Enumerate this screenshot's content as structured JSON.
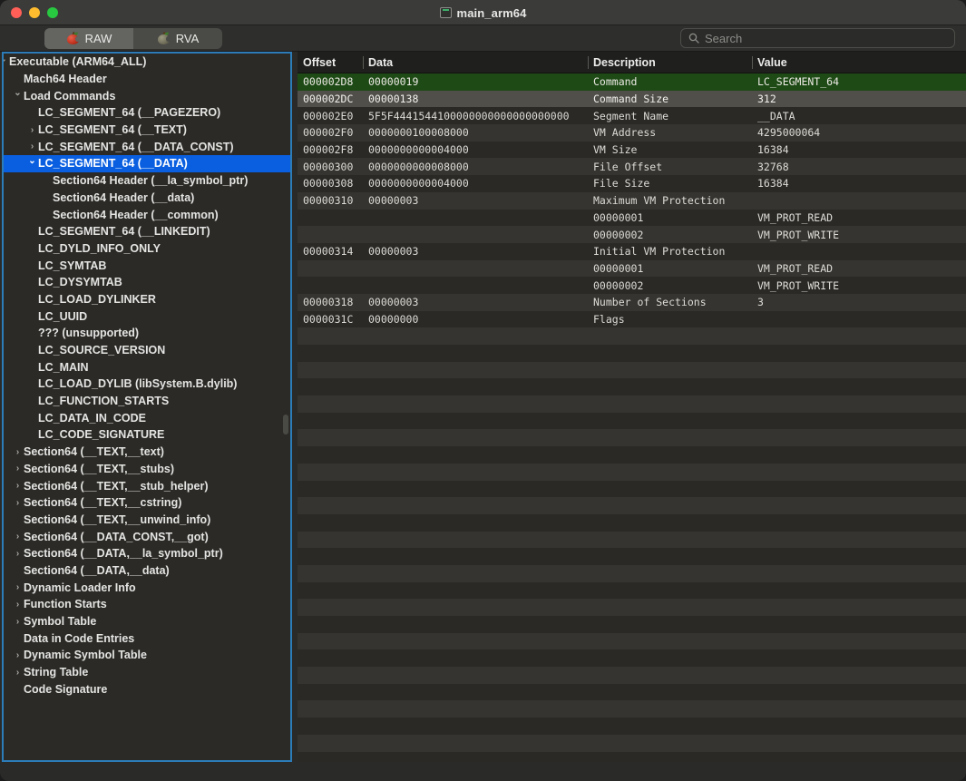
{
  "window": {
    "title": "main_arm64",
    "traffic_lights": [
      "close",
      "minimize",
      "maximize"
    ],
    "colors": {
      "close": "#ff5f57",
      "minimize": "#febc2e",
      "maximize": "#28c840",
      "selection_blue": "#0a5fe0",
      "focus_ring": "#2b7cb8",
      "row_selected_green": "#1e4a16"
    }
  },
  "toolbar": {
    "tabs": [
      {
        "label": "RAW",
        "icon": "apple-red-icon",
        "active": true
      },
      {
        "label": "RVA",
        "icon": "apple-grey-icon",
        "active": false
      }
    ],
    "search": {
      "placeholder": "Search",
      "value": "",
      "icon": "search-icon"
    }
  },
  "sidebar": {
    "items": [
      {
        "label": "Executable  (ARM64_ALL)",
        "depth": 0,
        "twisty": "down",
        "selected": false
      },
      {
        "label": "Mach64 Header",
        "depth": 1,
        "twisty": "none",
        "selected": false
      },
      {
        "label": "Load Commands",
        "depth": 1,
        "twisty": "down",
        "selected": false
      },
      {
        "label": "LC_SEGMENT_64 (__PAGEZERO)",
        "depth": 2,
        "twisty": "none",
        "selected": false
      },
      {
        "label": "LC_SEGMENT_64 (__TEXT)",
        "depth": 2,
        "twisty": "right",
        "selected": false
      },
      {
        "label": "LC_SEGMENT_64 (__DATA_CONST)",
        "depth": 2,
        "twisty": "right",
        "selected": false
      },
      {
        "label": "LC_SEGMENT_64 (__DATA)",
        "depth": 2,
        "twisty": "down",
        "selected": true
      },
      {
        "label": "Section64 Header (__la_symbol_ptr)",
        "depth": 3,
        "twisty": "none",
        "selected": false
      },
      {
        "label": "Section64 Header (__data)",
        "depth": 3,
        "twisty": "none",
        "selected": false
      },
      {
        "label": "Section64 Header (__common)",
        "depth": 3,
        "twisty": "none",
        "selected": false
      },
      {
        "label": "LC_SEGMENT_64 (__LINKEDIT)",
        "depth": 2,
        "twisty": "none",
        "selected": false
      },
      {
        "label": "LC_DYLD_INFO_ONLY",
        "depth": 2,
        "twisty": "none",
        "selected": false
      },
      {
        "label": "LC_SYMTAB",
        "depth": 2,
        "twisty": "none",
        "selected": false
      },
      {
        "label": "LC_DYSYMTAB",
        "depth": 2,
        "twisty": "none",
        "selected": false
      },
      {
        "label": "LC_LOAD_DYLINKER",
        "depth": 2,
        "twisty": "none",
        "selected": false
      },
      {
        "label": "LC_UUID",
        "depth": 2,
        "twisty": "none",
        "selected": false
      },
      {
        "label": "??? (unsupported)",
        "depth": 2,
        "twisty": "none",
        "selected": false
      },
      {
        "label": "LC_SOURCE_VERSION",
        "depth": 2,
        "twisty": "none",
        "selected": false
      },
      {
        "label": "LC_MAIN",
        "depth": 2,
        "twisty": "none",
        "selected": false
      },
      {
        "label": "LC_LOAD_DYLIB (libSystem.B.dylib)",
        "depth": 2,
        "twisty": "none",
        "selected": false
      },
      {
        "label": "LC_FUNCTION_STARTS",
        "depth": 2,
        "twisty": "none",
        "selected": false
      },
      {
        "label": "LC_DATA_IN_CODE",
        "depth": 2,
        "twisty": "none",
        "selected": false
      },
      {
        "label": "LC_CODE_SIGNATURE",
        "depth": 2,
        "twisty": "none",
        "selected": false
      },
      {
        "label": "Section64 (__TEXT,__text)",
        "depth": 1,
        "twisty": "right",
        "selected": false
      },
      {
        "label": "Section64 (__TEXT,__stubs)",
        "depth": 1,
        "twisty": "right",
        "selected": false
      },
      {
        "label": "Section64 (__TEXT,__stub_helper)",
        "depth": 1,
        "twisty": "right",
        "selected": false
      },
      {
        "label": "Section64 (__TEXT,__cstring)",
        "depth": 1,
        "twisty": "right",
        "selected": false
      },
      {
        "label": "Section64 (__TEXT,__unwind_info)",
        "depth": 1,
        "twisty": "none",
        "selected": false
      },
      {
        "label": "Section64 (__DATA_CONST,__got)",
        "depth": 1,
        "twisty": "right",
        "selected": false
      },
      {
        "label": "Section64 (__DATA,__la_symbol_ptr)",
        "depth": 1,
        "twisty": "right",
        "selected": false
      },
      {
        "label": "Section64 (__DATA,__data)",
        "depth": 1,
        "twisty": "none",
        "selected": false
      },
      {
        "label": "Dynamic Loader Info",
        "depth": 1,
        "twisty": "right",
        "selected": false
      },
      {
        "label": "Function Starts",
        "depth": 1,
        "twisty": "right",
        "selected": false
      },
      {
        "label": "Symbol Table",
        "depth": 1,
        "twisty": "right",
        "selected": false
      },
      {
        "label": "Data in Code Entries",
        "depth": 1,
        "twisty": "none",
        "selected": false
      },
      {
        "label": "Dynamic Symbol Table",
        "depth": 1,
        "twisty": "right",
        "selected": false
      },
      {
        "label": "String Table",
        "depth": 1,
        "twisty": "right",
        "selected": false
      },
      {
        "label": "Code Signature",
        "depth": 1,
        "twisty": "none",
        "selected": false
      }
    ]
  },
  "table": {
    "columns": [
      "Offset",
      "Data",
      "Description",
      "Value"
    ],
    "rows": [
      {
        "offset": "000002D8",
        "data": "00000019",
        "description": "Command",
        "value": "LC_SEGMENT_64",
        "state": "selected"
      },
      {
        "offset": "000002DC",
        "data": "00000138",
        "description": "Command Size",
        "value": "312",
        "state": "selected2"
      },
      {
        "offset": "000002E0",
        "data": "5F5F4441544100000000000000000000",
        "description": "Segment Name",
        "value": "__DATA",
        "state": "odd"
      },
      {
        "offset": "000002F0",
        "data": "0000000100008000",
        "description": "VM Address",
        "value": "4295000064",
        "state": "even"
      },
      {
        "offset": "000002F8",
        "data": "0000000000004000",
        "description": "VM Size",
        "value": "16384",
        "state": "odd"
      },
      {
        "offset": "00000300",
        "data": "0000000000008000",
        "description": "File Offset",
        "value": "32768",
        "state": "even"
      },
      {
        "offset": "00000308",
        "data": "0000000000004000",
        "description": "File Size",
        "value": "16384",
        "state": "odd"
      },
      {
        "offset": "00000310",
        "data": "00000003",
        "description": "Maximum VM Protection",
        "value": "",
        "state": "even"
      },
      {
        "offset": "",
        "data": "",
        "description": "00000001",
        "value": "VM_PROT_READ",
        "state": "odd"
      },
      {
        "offset": "",
        "data": "",
        "description": "00000002",
        "value": "VM_PROT_WRITE",
        "state": "even"
      },
      {
        "offset": "00000314",
        "data": "00000003",
        "description": "Initial VM Protection",
        "value": "",
        "state": "odd"
      },
      {
        "offset": "",
        "data": "",
        "description": "00000001",
        "value": "VM_PROT_READ",
        "state": "even"
      },
      {
        "offset": "",
        "data": "",
        "description": "00000002",
        "value": "VM_PROT_WRITE",
        "state": "odd"
      },
      {
        "offset": "00000318",
        "data": "00000003",
        "description": "Number of Sections",
        "value": "3",
        "state": "even"
      },
      {
        "offset": "0000031C",
        "data": "00000000",
        "description": "Flags",
        "value": "",
        "state": "odd"
      }
    ],
    "empty_row_count": 25
  }
}
